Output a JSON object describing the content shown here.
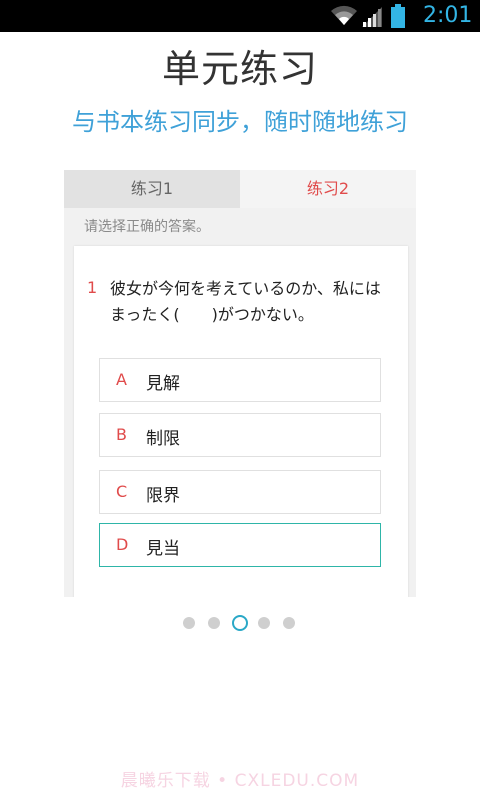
{
  "status_bar": {
    "time": "2:01"
  },
  "header": {
    "title": "单元练习",
    "subtitle": "与书本练习同步，随时随地练习"
  },
  "tabs": [
    {
      "label": "练习1",
      "active": false
    },
    {
      "label": "练习2",
      "active": true
    }
  ],
  "instruction": "请选择正确的答案。",
  "question": {
    "number": "1",
    "text": "彼女が今何を考えているのか、私にはまったく(　　)がつかない。",
    "options": [
      {
        "letter": "A",
        "text": "見解",
        "selected": false
      },
      {
        "letter": "B",
        "text": "制限",
        "selected": false
      },
      {
        "letter": "C",
        "text": "限界",
        "selected": false
      },
      {
        "letter": "D",
        "text": "見当",
        "selected": true
      }
    ]
  },
  "pager": {
    "count": 5,
    "active_index": 2
  },
  "watermark": "晨曦乐下载 • CXLEDU.COM",
  "colors": {
    "accent_blue": "#3fa1d8",
    "accent_red": "#e04b4b",
    "selected_border": "#2eb5a8",
    "status_icon": "#33b5e5"
  }
}
